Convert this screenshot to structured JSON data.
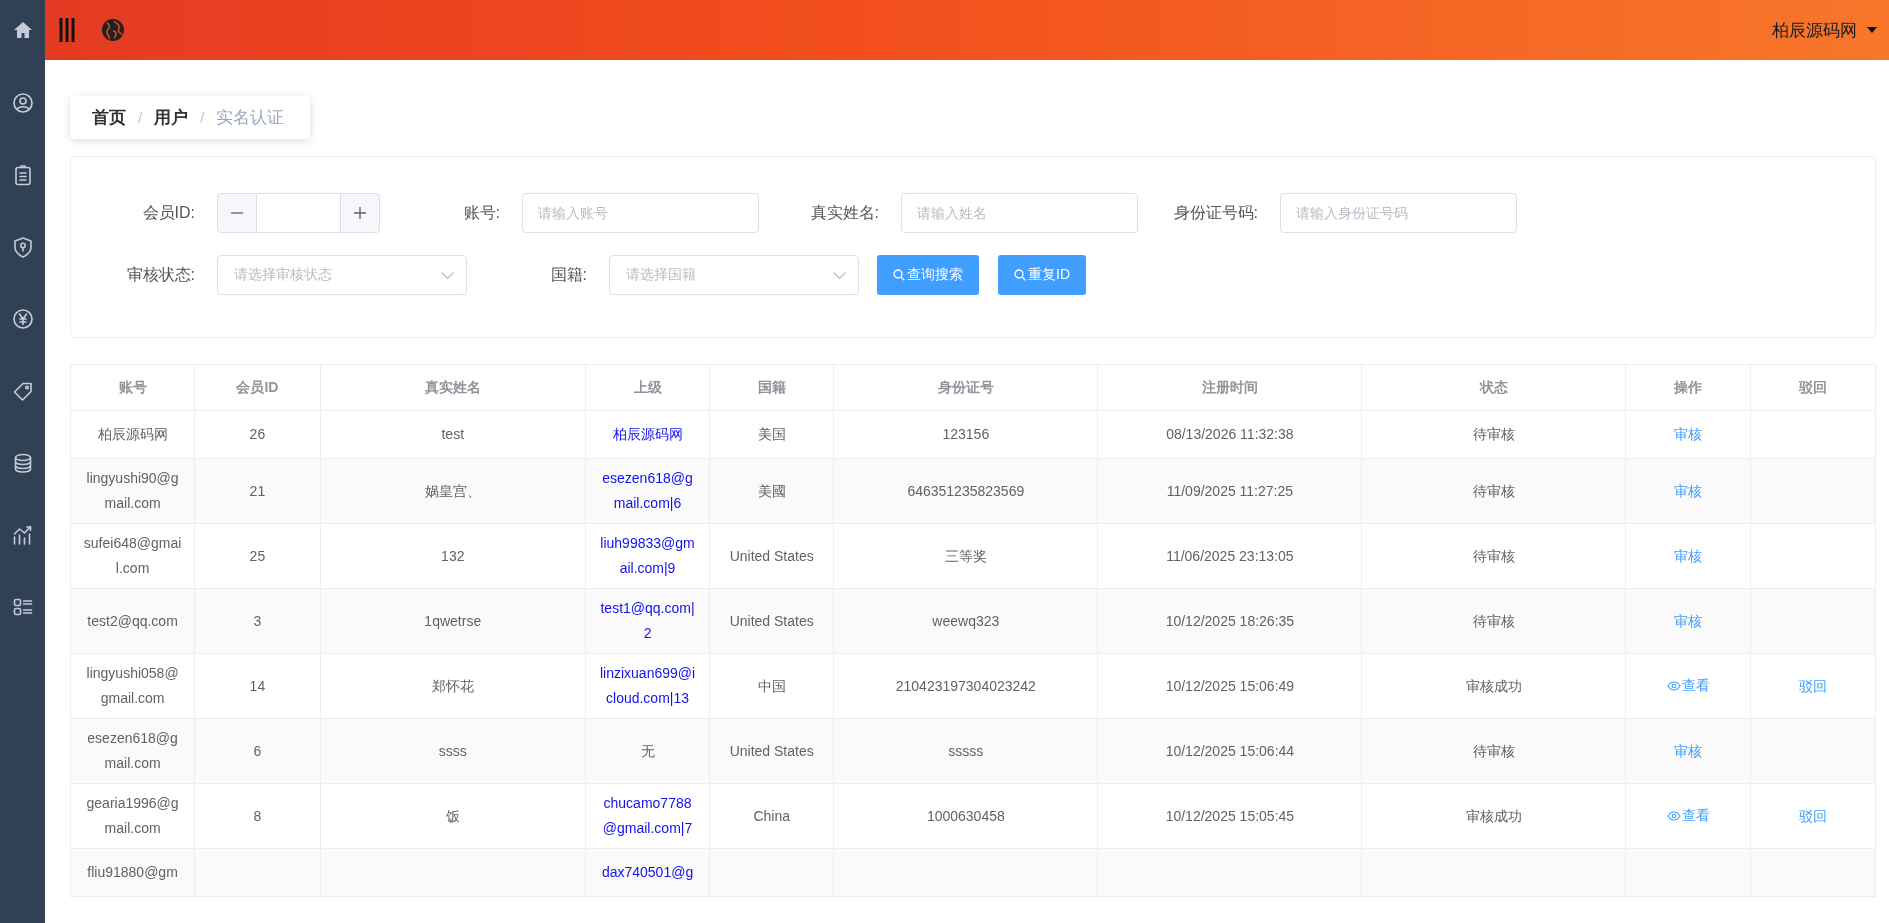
{
  "topbar": {
    "user_menu": "柏辰源码网"
  },
  "breadcrumb": {
    "items": [
      {
        "label": "首页",
        "current": false
      },
      {
        "label": "用户",
        "current": false
      },
      {
        "label": "实名认证",
        "current": true
      }
    ],
    "separators": [
      "/",
      "/"
    ]
  },
  "search": {
    "rows": [
      [
        {
          "kind": "number",
          "label": "会员ID:"
        },
        {
          "kind": "text",
          "label": "账号:",
          "placeholder": "请输入账号"
        },
        {
          "kind": "text",
          "label": "真实姓名:",
          "placeholder": "请输入姓名"
        },
        {
          "kind": "text",
          "label": "身份证号码:",
          "placeholder": "请输入身份证号码"
        }
      ],
      [
        {
          "kind": "select",
          "label": "审核状态:",
          "placeholder": "请选择审核状态"
        },
        {
          "kind": "select",
          "label": "国籍:",
          "placeholder": "请选择国籍"
        },
        {
          "kind": "button",
          "label": "查询搜索"
        },
        {
          "kind": "button",
          "label": "重复ID"
        }
      ]
    ]
  },
  "table": {
    "columns": [
      "账号",
      "会员ID",
      "真实姓名",
      "上级",
      "国籍",
      "身份证号",
      "注册时间",
      "状态",
      "操作",
      "驳回"
    ],
    "rows": [
      {
        "account": "柏辰源码网",
        "member_id": "26",
        "real_name": "test",
        "superior": {
          "text": "柏辰源码网",
          "link": true
        },
        "nationality": "美国",
        "id_number": "123156",
        "registered": "08/13/2026 11:32:38",
        "status": "待审核",
        "action": {
          "kind": "review",
          "label": "审核"
        }
      },
      {
        "account": "lingyushi90@gmail.com",
        "member_id": "21",
        "real_name": "娲皇宫、",
        "superior": {
          "text": "esezen618@gmail.com|6",
          "link": true
        },
        "nationality": "美國",
        "id_number": "646351235823569",
        "registered": "11/09/2025 11:27:25",
        "status": "待审核",
        "action": {
          "kind": "review",
          "label": "审核"
        }
      },
      {
        "account": "sufei648@gmail.com",
        "member_id": "25",
        "real_name": "132",
        "superior": {
          "text": "liuh99833@gmail.com|9",
          "link": true
        },
        "nationality": "United States",
        "id_number": "三等奖",
        "registered": "11/06/2025 23:13:05",
        "status": "待审核",
        "action": {
          "kind": "review",
          "label": "审核"
        }
      },
      {
        "account": "test2@qq.com",
        "member_id": "3",
        "real_name": "1qwetrse",
        "superior": {
          "text": "test1@qq.com|2",
          "link": true
        },
        "nationality": "United States",
        "id_number": "weewq323",
        "registered": "10/12/2025 18:26:35",
        "status": "待审核",
        "action": {
          "kind": "review",
          "label": "审核"
        }
      },
      {
        "account": "lingyushi058@gmail.com",
        "member_id": "14",
        "real_name": "郑怀花",
        "superior": {
          "text": "linzixuan699@icloud.com|13",
          "link": true
        },
        "nationality": "中国",
        "id_number": "210423197304023242",
        "registered": "10/12/2025 15:06:49",
        "status": "审核成功",
        "action": {
          "kind": "view",
          "label": "查看"
        },
        "reject": "驳回"
      },
      {
        "account": "esezen618@gmail.com",
        "member_id": "6",
        "real_name": "ssss",
        "superior": {
          "text": "无",
          "link": false
        },
        "nationality": "United States",
        "id_number": "sssss",
        "registered": "10/12/2025 15:06:44",
        "status": "待审核",
        "action": {
          "kind": "review",
          "label": "审核"
        }
      },
      {
        "account": "gearia1996@gmail.com",
        "member_id": "8",
        "real_name": "饭",
        "superior": {
          "text": "chucamo7788@gmail.com|7",
          "link": true
        },
        "nationality": "China",
        "id_number": "1000630458",
        "registered": "10/12/2025 15:05:45",
        "status": "审核成功",
        "action": {
          "kind": "view",
          "label": "查看"
        },
        "reject": "驳回"
      },
      {
        "account": "fliu91880@gm",
        "superior": {
          "text": "dax740501@g",
          "link": true
        }
      }
    ]
  }
}
